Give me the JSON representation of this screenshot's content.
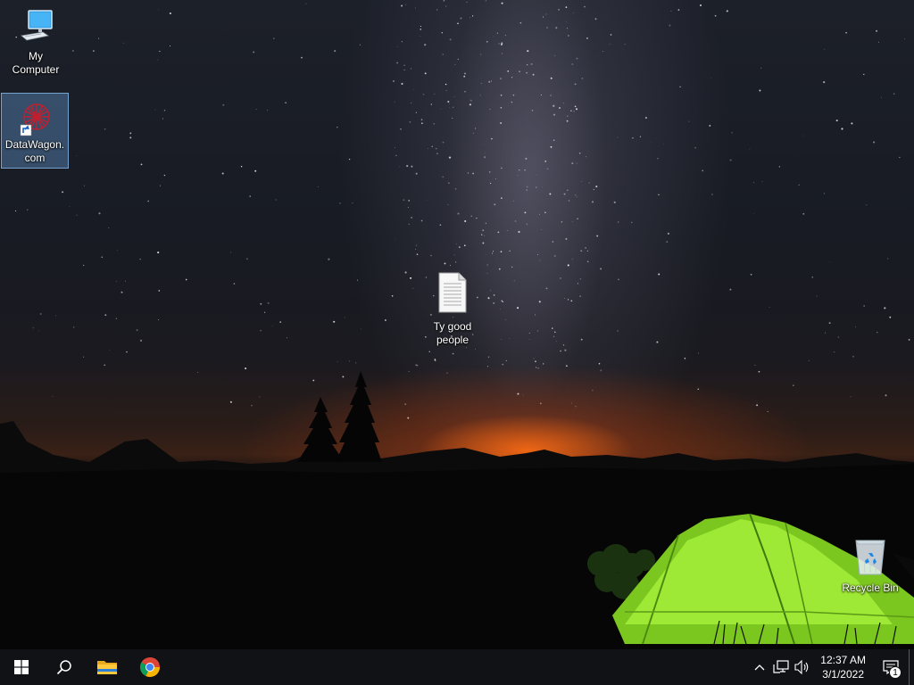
{
  "desktop": {
    "icons": [
      {
        "label": "My Computer",
        "icon": "computer-monitor-icon"
      },
      {
        "label": "DataWagon.com",
        "icon": "datawagon-shortcut-icon",
        "selected": true
      },
      {
        "label": "Ty good people",
        "icon": "text-document-icon"
      },
      {
        "label": "Recycle Bin",
        "icon": "recycle-bin-icon"
      }
    ]
  },
  "taskbar": {
    "start": "windows-start-icon",
    "search": "search-icon",
    "pinned": [
      "file-explorer-icon",
      "chrome-icon"
    ],
    "tray": {
      "icons": [
        "chevron-up-icon",
        "network-icon",
        "volume-icon"
      ],
      "time": "12:37 AM",
      "date": "3/1/2022",
      "notification_count": "1"
    }
  },
  "colors": {
    "taskbar": "#101216",
    "selection": "#5a8cbe",
    "tent": "#8fdc2a",
    "horizon_glow": "#ff6e14"
  }
}
